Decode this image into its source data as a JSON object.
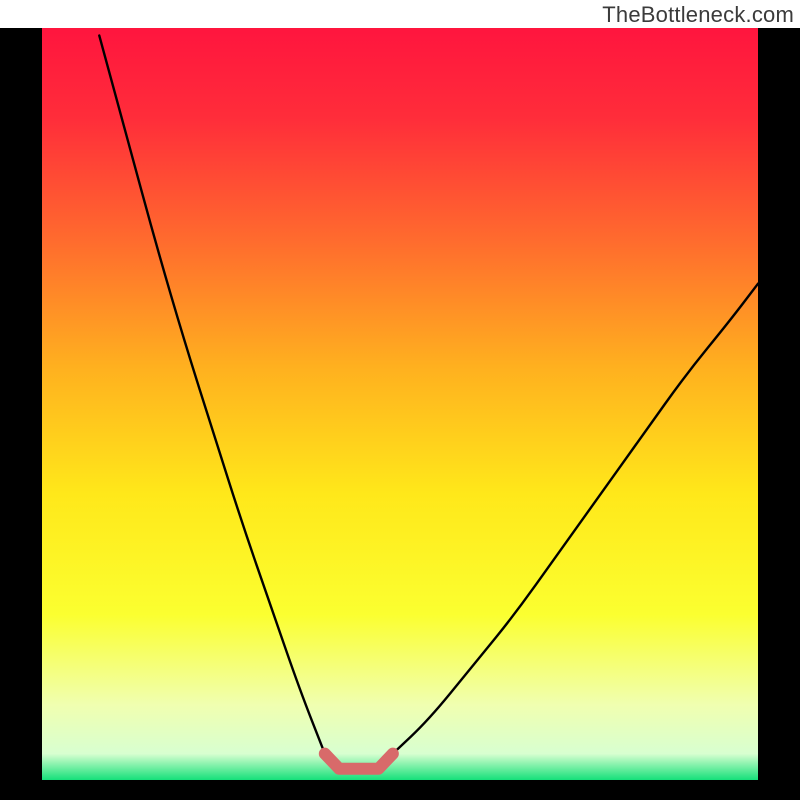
{
  "watermark": "TheBottleneck.com",
  "chart_data": {
    "type": "line",
    "title": "",
    "xlabel": "",
    "ylabel": "",
    "xlim": [
      0,
      100
    ],
    "ylim": [
      0,
      100
    ],
    "series": [
      {
        "name": "curve-left",
        "x": [
          8,
          12,
          16,
          20,
          24,
          28,
          32,
          36,
          39.5
        ],
        "values": [
          99,
          85,
          71,
          58,
          46,
          34,
          23,
          12,
          3.5
        ]
      },
      {
        "name": "curve-right",
        "x": [
          49,
          54,
          60,
          66,
          72,
          78,
          84,
          90,
          96,
          100
        ],
        "values": [
          3.5,
          8,
          15,
          22,
          30,
          38,
          46,
          54,
          61,
          66
        ]
      },
      {
        "name": "highlight-segment",
        "x": [
          39.5,
          41.5,
          47,
          49
        ],
        "values": [
          3.5,
          1.5,
          1.5,
          3.5
        ]
      }
    ],
    "gradient_stops": [
      {
        "offset": 0.0,
        "color": "#ff153e"
      },
      {
        "offset": 0.12,
        "color": "#ff2d3a"
      },
      {
        "offset": 0.28,
        "color": "#ff6a2e"
      },
      {
        "offset": 0.45,
        "color": "#ffb01f"
      },
      {
        "offset": 0.62,
        "color": "#ffe81a"
      },
      {
        "offset": 0.78,
        "color": "#fbff30"
      },
      {
        "offset": 0.9,
        "color": "#f0ffb0"
      },
      {
        "offset": 0.965,
        "color": "#d8ffd0"
      },
      {
        "offset": 1.0,
        "color": "#15e07a"
      }
    ],
    "colors": {
      "frame": "#000000",
      "curve": "#000000",
      "highlight": "#d86a6a"
    }
  }
}
